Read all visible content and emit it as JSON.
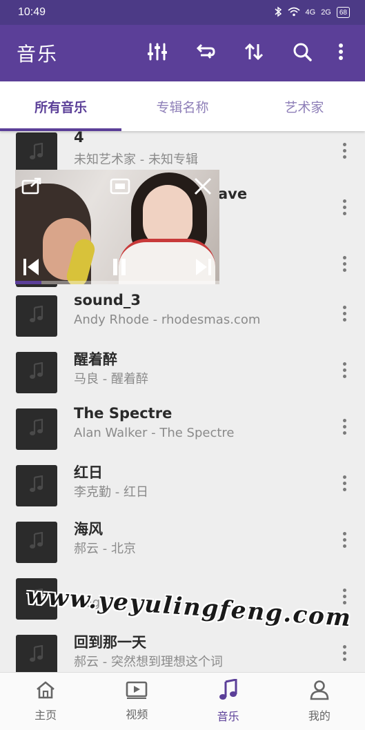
{
  "status_bar": {
    "time": "10:49",
    "network_1": "4G",
    "network_2": "2G",
    "battery": "68"
  },
  "app_bar": {
    "title": "音乐",
    "actions": [
      "equalizer-icon",
      "repeat-icon",
      "sort-icon",
      "search-icon",
      "more-vert-icon"
    ]
  },
  "tabs": [
    {
      "label": "所有音乐",
      "active": true
    },
    {
      "label": "专辑名称",
      "active": false
    },
    {
      "label": "艺术家",
      "active": false
    }
  ],
  "songs": [
    {
      "title": "4",
      "subtitle": "未知艺术家 - 未知专辑"
    },
    {
      "title": "ave",
      "subtitle": ""
    },
    {
      "title": "",
      "subtitle": ""
    },
    {
      "title": "sound_3",
      "subtitle": "Andy Rhode - rhodesmas.com"
    },
    {
      "title": "醒着醉",
      "subtitle": "马良 - 醒着醉"
    },
    {
      "title": "The Spectre",
      "subtitle": "Alan Walker - The Spectre"
    },
    {
      "title": "红日",
      "subtitle": "李克勤 - 红日"
    },
    {
      "title": "海风",
      "subtitle": "郝云 - 北京"
    },
    {
      "title": "",
      "subtitle": "Tragedi"
    },
    {
      "title": "回到那一天",
      "subtitle": "郝云 - 突然想到理想这个词"
    }
  ],
  "floating_player": {
    "progress": 0.13,
    "icons": [
      "expand-icon",
      "pip-window-icon",
      "close-icon",
      "previous-icon",
      "pause-icon",
      "next-icon"
    ]
  },
  "watermark": "www.yeyulingfeng.com",
  "bottom_nav": [
    {
      "label": "主页",
      "icon": "home-icon",
      "active": false
    },
    {
      "label": "视频",
      "icon": "video-icon",
      "active": false
    },
    {
      "label": "音乐",
      "icon": "music-note-icon",
      "active": true
    },
    {
      "label": "我的",
      "icon": "person-icon",
      "active": false
    }
  ],
  "colors": {
    "primary": "#5b3f98",
    "status_bar": "#4c3a86",
    "list_bg": "#eeeeee"
  }
}
